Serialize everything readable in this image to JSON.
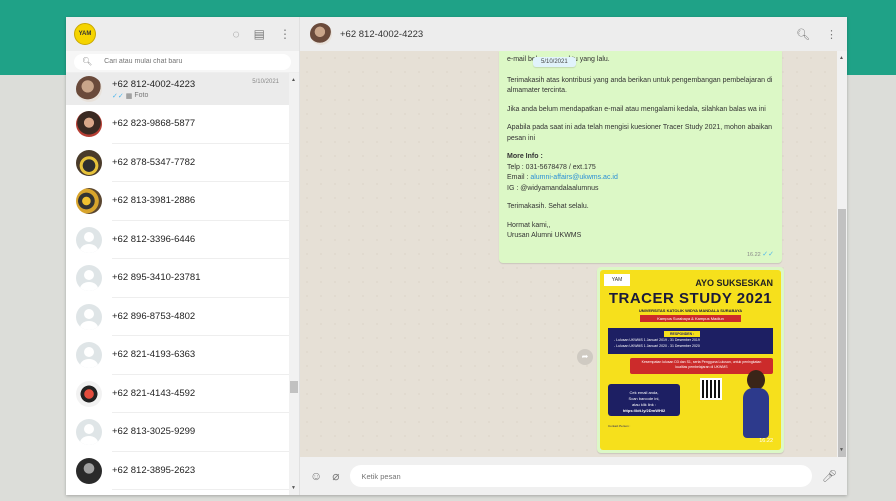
{
  "sidebar": {
    "logo_text": "YAM",
    "search_placeholder": "Cari atau mulai chat baru",
    "chats": [
      {
        "name": "+62 812-4002-4223",
        "date": "5/10/2021",
        "sub": "Foto",
        "avatar": "photo1",
        "active": true
      },
      {
        "name": "+62 823-9868-5877",
        "avatar": "photo2"
      },
      {
        "name": "+62 878-5347-7782",
        "avatar": "photo3"
      },
      {
        "name": "+62 813-3981-2886",
        "avatar": "photo4"
      },
      {
        "name": "+62 812-3396-6446",
        "avatar": "default"
      },
      {
        "name": "+62 895-3410-23781",
        "avatar": "default"
      },
      {
        "name": "+62 896-8753-4802",
        "avatar": "default"
      },
      {
        "name": "+62 821-4193-6363",
        "avatar": "default"
      },
      {
        "name": "+62 821-4143-4592",
        "avatar": "photo5"
      },
      {
        "name": "+62 813-3025-9299",
        "avatar": "default"
      },
      {
        "name": "+62 812-3895-2623",
        "avatar": "photo6"
      }
    ]
  },
  "header": {
    "contact": "+62 812-4002-4223"
  },
  "message": {
    "date_pill": "5/10/2021",
    "line1": "e-mail beberapa waktu yang lalu.",
    "para1": "Terimakasih atas kontribusi yang anda berikan untuk pengembangan pembelajaran di almamater tercinta.",
    "para2": "Jika anda belum mendapatkan e-mail atau mengalami kedala, silahkan balas wa ini",
    "para3": "Apabila pada saat ini ada telah mengisi kuesioner Tracer Study 2021, mohon abaikan pesan ini",
    "more_info": "More Info :",
    "telp": "Telp : 031-5678478 / ext.175",
    "email_label": "Email : ",
    "email": "alumni-affairs@ukwms.ac.id",
    "ig": "IG : @widyamandalaalumnus",
    "thanks": "Terimakasih.  Sehat selalu.",
    "regards": "Hormat kami,,",
    "sender": "Urusan Alumni UKWMS",
    "time": "16.22"
  },
  "poster": {
    "ayo": "AYO SUKSESKAN",
    "title": "TRACER STUDY 2021",
    "univ": "UNIVERSITAS KATOLIK WIDYA MANDALA SURABAYA",
    "campus": "Kampus Surabaya & Kampus Madiun",
    "resp": "RESPONDEN :",
    "resp1": "- Lulusan UKWMS 1 Januari 2019 - 31 Desember 2019",
    "resp2": "- Lulusan UKWMS 1 Januari 2020 - 31 Desember 2020",
    "note": "Kesempatan lulusan D3 dan S1, serta Pengguna Lulusan, untuk peningkatan kualitas pembelajaran di UKWMS",
    "cek1": "Cek email anda,",
    "cek2": "Scan barcode ini,",
    "cek3": "atau klik link :",
    "link": "https://bit.ly/2DmWHI2",
    "contact": "Contact Person :",
    "time": "16.22"
  },
  "composer": {
    "placeholder": "Ketik pesan"
  }
}
